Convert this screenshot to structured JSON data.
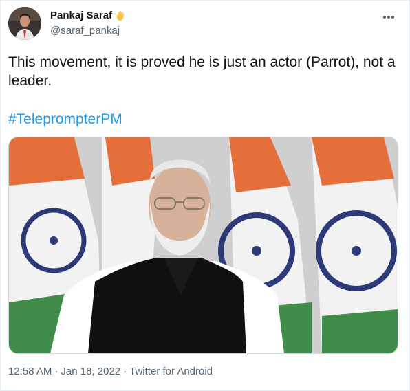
{
  "author": {
    "name": "Pankaj Saraf",
    "name_emoji": "✋",
    "handle": "@saraf_pankaj"
  },
  "tweet": {
    "text": "This movement, it is proved he is just an actor (Parrot), not a leader.",
    "hashtag": "#TeleprompterPM"
  },
  "meta": {
    "time": "12:58 AM",
    "date": "Jan 18, 2022",
    "separator": "·",
    "source": "Twitter for Android"
  },
  "colors": {
    "link": "#1d9bf0",
    "secondary_text": "#536471"
  },
  "icons": [
    "more-options-icon",
    "raised-hand-emoji"
  ]
}
